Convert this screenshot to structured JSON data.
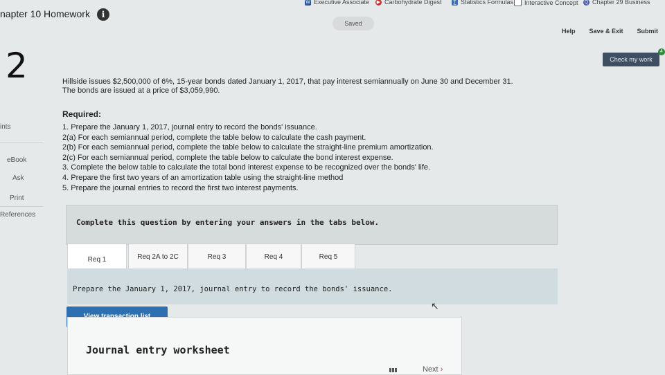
{
  "bookmarks": [
    {
      "icon": "word-icon",
      "label": "Executive Associate"
    },
    {
      "icon": "play-icon",
      "label": "Carbohydrate Digest"
    },
    {
      "icon": "calculator-icon",
      "label": "Statistics Formulas"
    },
    {
      "icon": "document-icon",
      "label": "Interactive Concept"
    },
    {
      "icon": "quizlet-icon",
      "label": "Chapter 29 Business"
    }
  ],
  "header": {
    "chapter_title": "napter 10 Homework",
    "info_icon": "i",
    "saved": "Saved",
    "help": "Help",
    "save_exit": "Save & Exit",
    "submit": "Submit",
    "check_work": "Check my work",
    "check_badge": "4"
  },
  "question_number": "2",
  "sidebar": {
    "points": "ints",
    "ebook": "eBook",
    "ask": "Ask",
    "print": "Print",
    "references": "References"
  },
  "problem": {
    "line1": "Hillside issues $2,500,000 of 6%, 15-year bonds dated January 1, 2017, that pay interest semiannually on June 30 and December 31.",
    "line2": "The bonds are issued at a price of $3,059,990."
  },
  "required": {
    "title": "Required:",
    "items": [
      "1. Prepare the January 1, 2017, journal entry to record the bonds' issuance.",
      "2(a) For each semiannual period, complete the table below to calculate the cash payment.",
      "2(b) For each semiannual period, complete the table below to calculate the straight-line premium amortization.",
      "2(c) For each semiannual period, complete the table below to calculate the bond interest expense.",
      "3. Complete the below table to calculate the total bond interest expense to be recognized over the bonds' life.",
      "4. Prepare the first two years of an amortization table using the straight-line method",
      "5. Prepare the journal entries to record the first two interest payments."
    ]
  },
  "complete_prompt": "Complete this question by entering your answers in the tabs below.",
  "tabs": [
    "Req 1",
    "Req 2A to 2C",
    "Req 3",
    "Req 4",
    "Req 5"
  ],
  "instruction": "Prepare the January 1, 2017, journal entry to record the bonds' issuance.",
  "view_transaction_list": "View transaction list",
  "journal_title": "Journal entry worksheet",
  "next": "Next"
}
